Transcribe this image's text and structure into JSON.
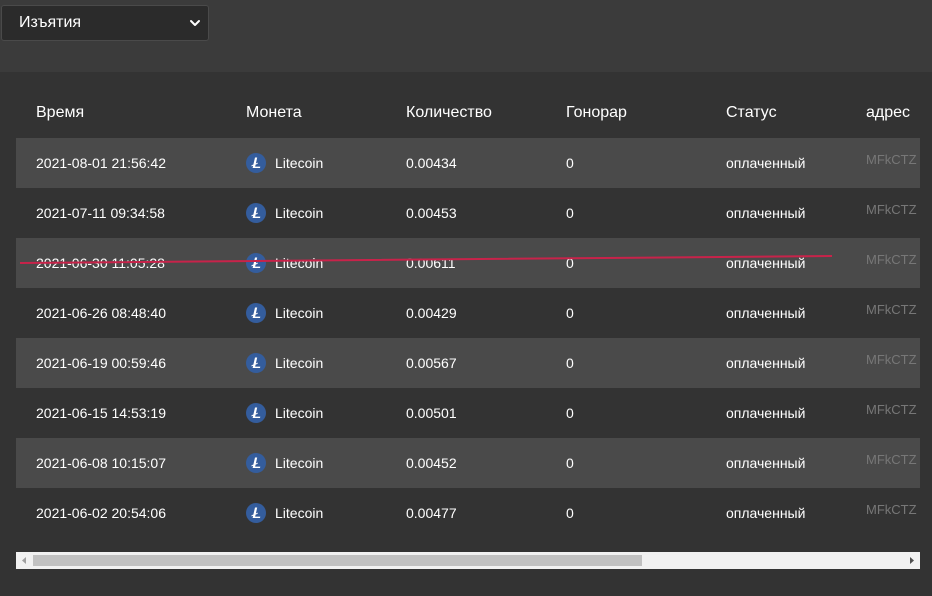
{
  "filter": {
    "selected": "Изъятия"
  },
  "table": {
    "columns": [
      "Время",
      "Монета",
      "Количество",
      "Гонорар",
      "Статус",
      "адрес"
    ],
    "rows": [
      {
        "time": "2021-08-01 21:56:42",
        "coin": "Litecoin",
        "amount": "0.00434",
        "fee": "0",
        "status": "оплаченный",
        "address": "MFkCTZ"
      },
      {
        "time": "2021-07-11 09:34:58",
        "coin": "Litecoin",
        "amount": "0.00453",
        "fee": "0",
        "status": "оплаченный",
        "address": "MFkCTZ"
      },
      {
        "time": "2021-06-30 11:05:28",
        "coin": "Litecoin",
        "amount": "0.00611",
        "fee": "0",
        "status": "оплаченный",
        "address": "MFkCTZ"
      },
      {
        "time": "2021-06-26 08:48:40",
        "coin": "Litecoin",
        "amount": "0.00429",
        "fee": "0",
        "status": "оплаченный",
        "address": "MFkCTZ"
      },
      {
        "time": "2021-06-19 00:59:46",
        "coin": "Litecoin",
        "amount": "0.00567",
        "fee": "0",
        "status": "оплаченный",
        "address": "MFkCTZ"
      },
      {
        "time": "2021-06-15 14:53:19",
        "coin": "Litecoin",
        "amount": "0.00501",
        "fee": "0",
        "status": "оплаченный",
        "address": "MFkCTZ"
      },
      {
        "time": "2021-06-08 10:15:07",
        "coin": "Litecoin",
        "amount": "0.00452",
        "fee": "0",
        "status": "оплаченный",
        "address": "MFkCTZ"
      },
      {
        "time": "2021-06-02 20:54:06",
        "coin": "Litecoin",
        "amount": "0.00477",
        "fee": "0",
        "status": "оплаченный",
        "address": "MFkCTZ"
      }
    ]
  },
  "icons": {
    "coin": "litecoin-icon",
    "select": "chevron-down-icon",
    "scroll_left": "arrow-left-icon",
    "scroll_right": "arrow-right-icon"
  },
  "colors": {
    "litecoin": "#345d9d",
    "highlight_underline": "#c8234a",
    "row_alt": "#4a4a4a",
    "row_base": "#333333"
  },
  "scroll": {
    "horizontal_thumb_fraction": 0.7
  }
}
